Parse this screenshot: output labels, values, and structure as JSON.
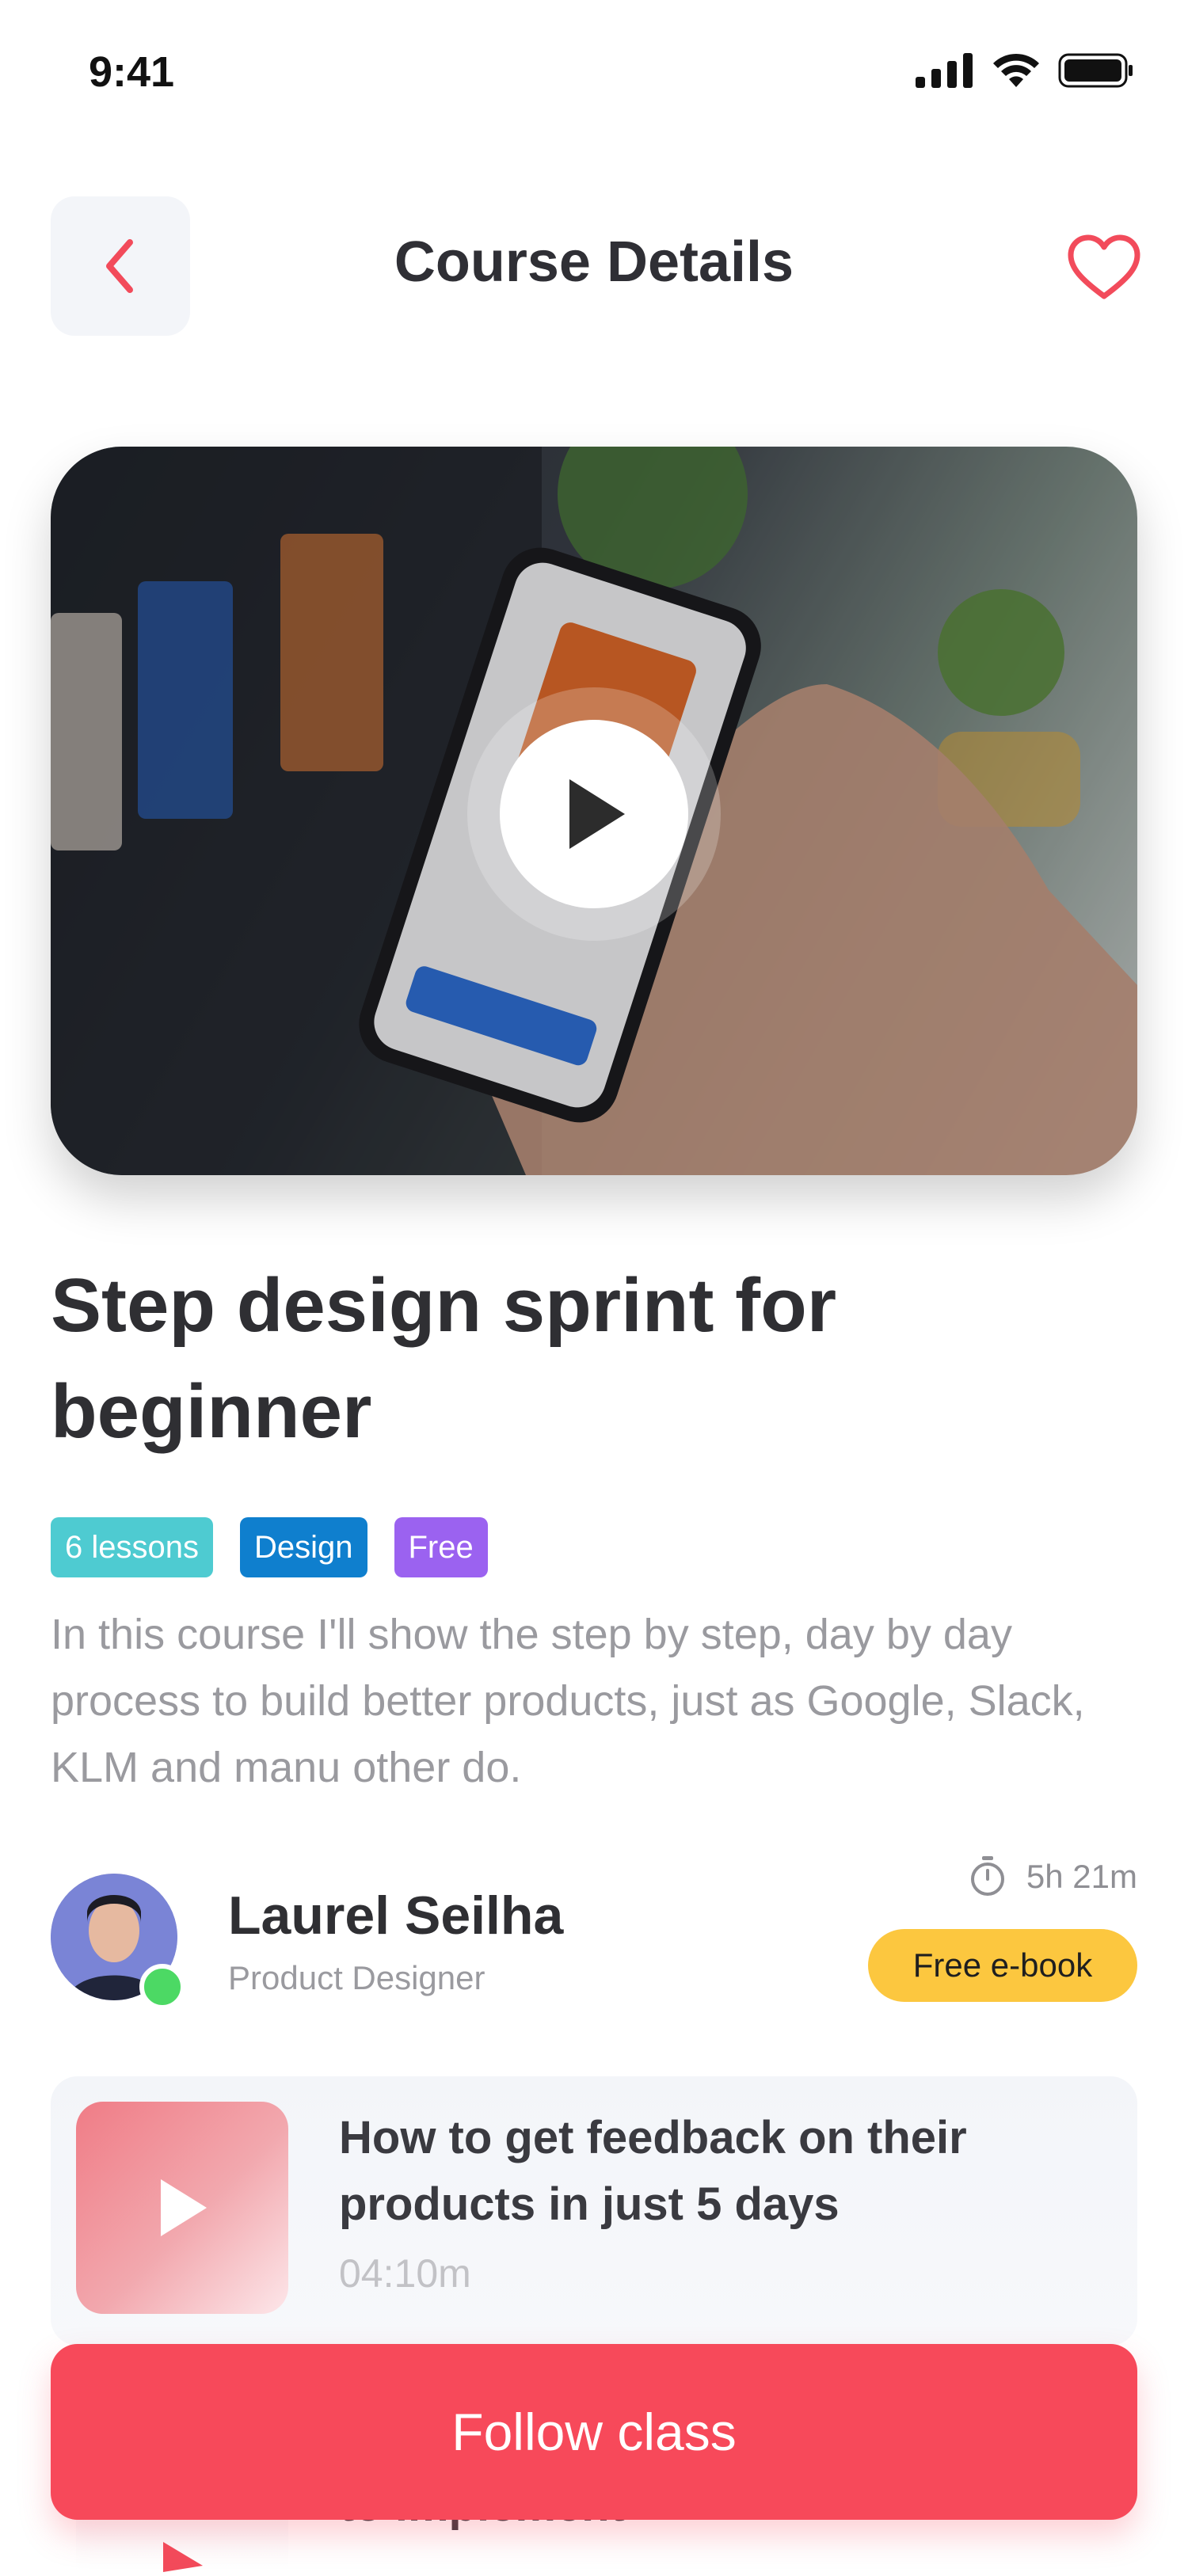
{
  "status_bar": {
    "time": "9:41"
  },
  "header": {
    "title": "Course Details"
  },
  "course": {
    "title": "Step design sprint for beginner",
    "tags": [
      {
        "label": "6 lessons",
        "color": "#4ecbd1"
      },
      {
        "label": "Design",
        "color": "#0f7fce"
      },
      {
        "label": "Free",
        "color": "#9b62f0"
      }
    ],
    "description": "In this course I'll show the step by step, day by day process to build better products, just as Google, Slack, KLM and manu other do."
  },
  "instructor": {
    "name": "Laurel Seilha",
    "role": "Product Designer",
    "duration": "5h 21m",
    "ebook_label": "Free e-book"
  },
  "lesson": {
    "title": "How to get feedback on their products in just 5 days",
    "time": "04:10m"
  },
  "next_lesson_peek": "to implement",
  "actions": {
    "follow_label": "Follow class"
  },
  "colors": {
    "accent": "#f7495a",
    "ebook": "#fcc73f"
  }
}
